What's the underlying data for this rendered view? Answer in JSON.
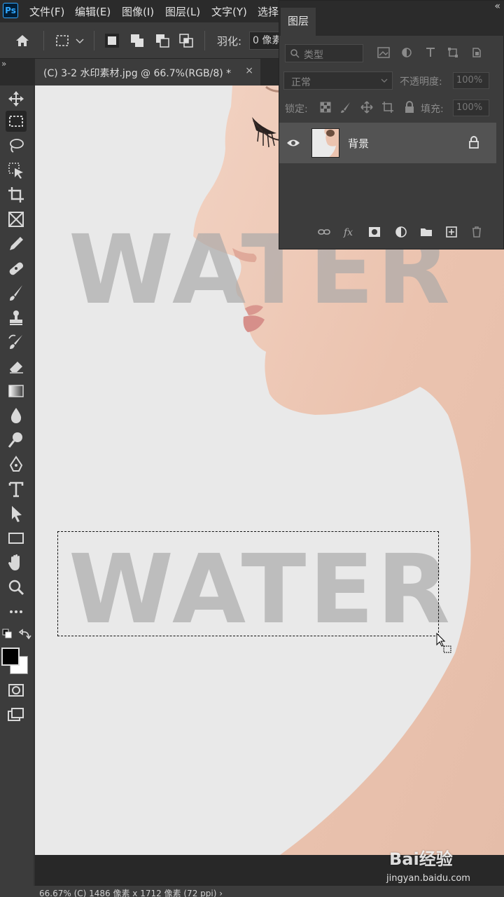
{
  "app": {
    "logo": "Ps"
  },
  "menu": [
    "文件(F)",
    "编辑(E)",
    "图像(I)",
    "图层(L)",
    "文字(Y)",
    "选择"
  ],
  "options": {
    "feather_label": "羽化:",
    "feather_value": "0 像素"
  },
  "document_tab": {
    "title": "(C) 3-2 水印素材.jpg @ 66.7%(RGB/8) *",
    "close": "×"
  },
  "canvas": {
    "watermark_top": "WATER",
    "watermark_bottom": "WATER"
  },
  "layers_panel": {
    "tab": "图层",
    "filter_label": "类型",
    "blend_mode": "正常",
    "opacity_label": "不透明度:",
    "opacity_value": "100%",
    "lock_label": "锁定:",
    "fill_label": "填充:",
    "fill_value": "100%",
    "layer_name": "背景"
  },
  "status": {
    "text": "66.67% (C) 1486 像素 x 1712 像素 (72 ppi) ›"
  },
  "site_watermark": {
    "brand": "Bai经验",
    "url": "jingyan.baidu.com"
  },
  "colors": {
    "ui_bg": "#3c3c3c",
    "canvas_bg": "#e9e9e9",
    "skin": "#eec7b4",
    "accent": "#31a8ff"
  }
}
